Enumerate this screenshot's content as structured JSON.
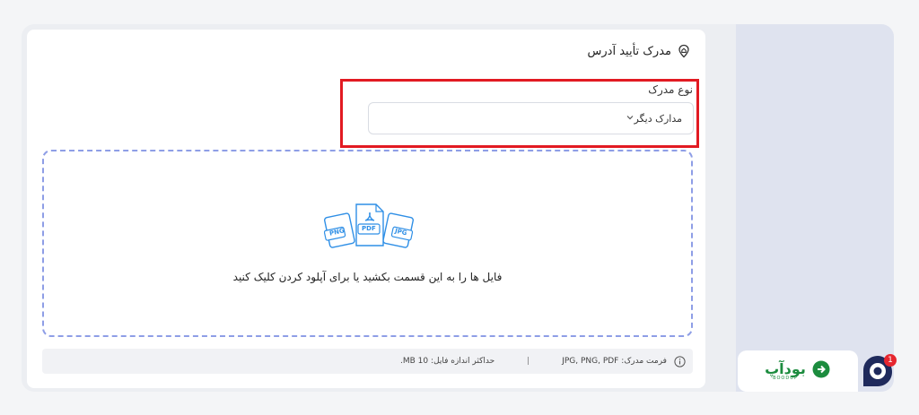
{
  "section": {
    "title": "مدرک تأیید آدرس",
    "icon": "location-pin-icon"
  },
  "document_type": {
    "label": "نوع مدرک",
    "selected": "مدارک دیگر"
  },
  "upload": {
    "instruction": "فایل ها را به این قسمت بکشید یا برای آپلود کردن کلیک کنید",
    "file_badges": [
      "PNG",
      "PDF",
      "JPG"
    ]
  },
  "info": {
    "formats": "فرمت مدرک: JPG, PNG, PDF",
    "separator": "|",
    "max_size": "حداکثر اندازه فایل: 10 MB."
  },
  "brand": {
    "name": "بودآپ",
    "sub": "BOODUP"
  },
  "chat": {
    "badge_count": "1"
  },
  "colors": {
    "highlight": "#e21a22",
    "accent": "#2f8fe6",
    "brand_green": "#1c8c3e",
    "dashed_border": "#8e9ee6"
  }
}
